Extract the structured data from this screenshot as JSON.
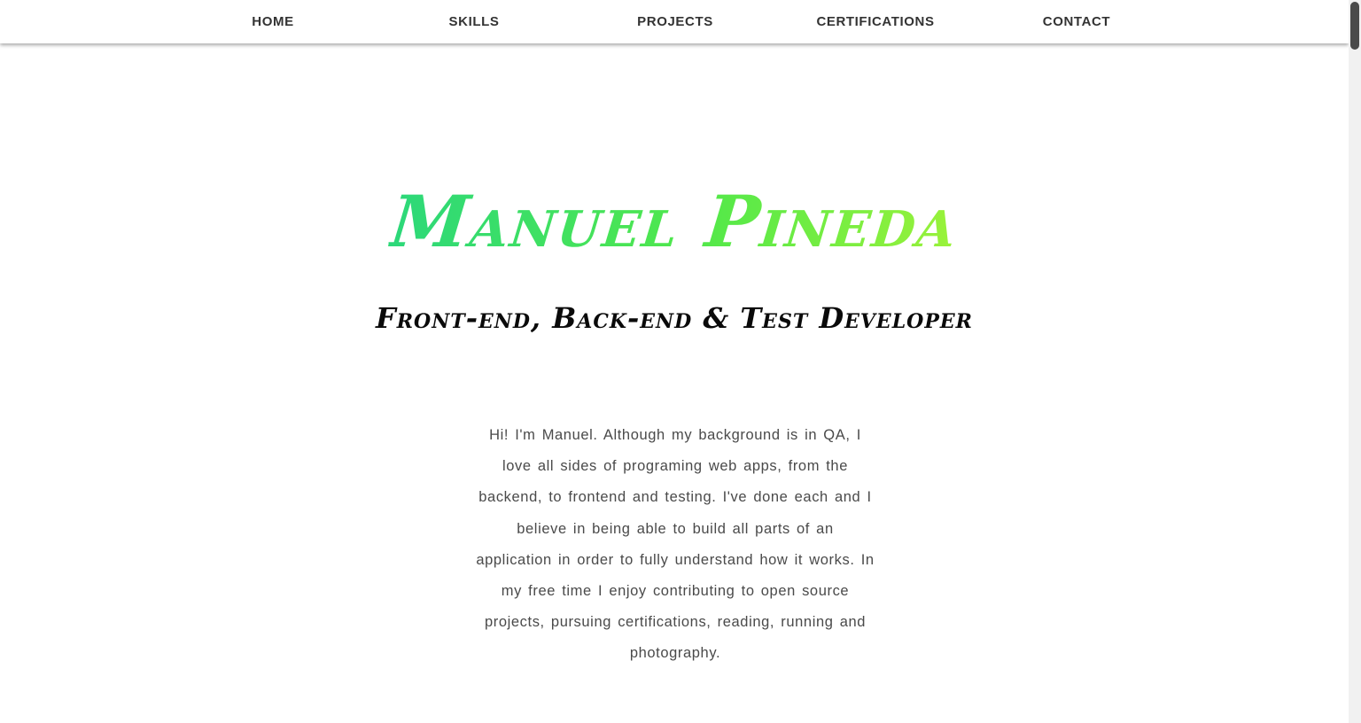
{
  "nav": {
    "items": [
      {
        "label": "HOME"
      },
      {
        "label": "SKILLS"
      },
      {
        "label": "PROJECTS"
      },
      {
        "label": "CERTIFICATIONS"
      },
      {
        "label": "CONTACT"
      }
    ]
  },
  "hero": {
    "name": "Manuel Pineda",
    "subtitle": "Front-end, Back-end & Test Developer",
    "bio": "Hi! I'm Manuel. Although my background is in QA, I love all sides of programing web apps, from the backend, to frontend and testing. I've done each and I believe in being able to build all parts of an application in order to fully understand how it works. In my free time I enjoy contributing to open source projects, pursuing certifications, reading, running and photography."
  },
  "colors": {
    "name_gradient_start": "#2cd87a",
    "name_gradient_end": "#9af23a",
    "subtitle": "#0a0a0a",
    "bio_text": "#4a4a4a",
    "nav_text": "#333333"
  }
}
